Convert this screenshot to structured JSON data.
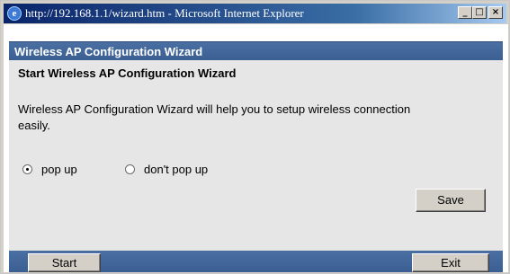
{
  "window": {
    "title": "http://192.168.1.1/wizard.htm - Microsoft Internet Explorer",
    "buttons": {
      "minimize": "_",
      "maximize": "□",
      "close": "×"
    }
  },
  "header": {
    "title": "Wireless AP Configuration Wizard"
  },
  "wizard": {
    "heading": "Start Wireless AP Configuration Wizard",
    "description": "Wireless AP Configuration Wizard will help you to setup wireless connection easily.",
    "options": [
      {
        "label": "pop up",
        "selected": true
      },
      {
        "label": "don't pop up",
        "selected": false
      }
    ],
    "save_label": "Save"
  },
  "footer": {
    "start_label": "Start",
    "exit_label": "Exit"
  },
  "colors": {
    "header_bar": "#3b5f92",
    "panel_bg": "#e6e6e6",
    "button_face": "#d4d0c8"
  },
  "icons": {
    "browser": "ie-icon"
  }
}
